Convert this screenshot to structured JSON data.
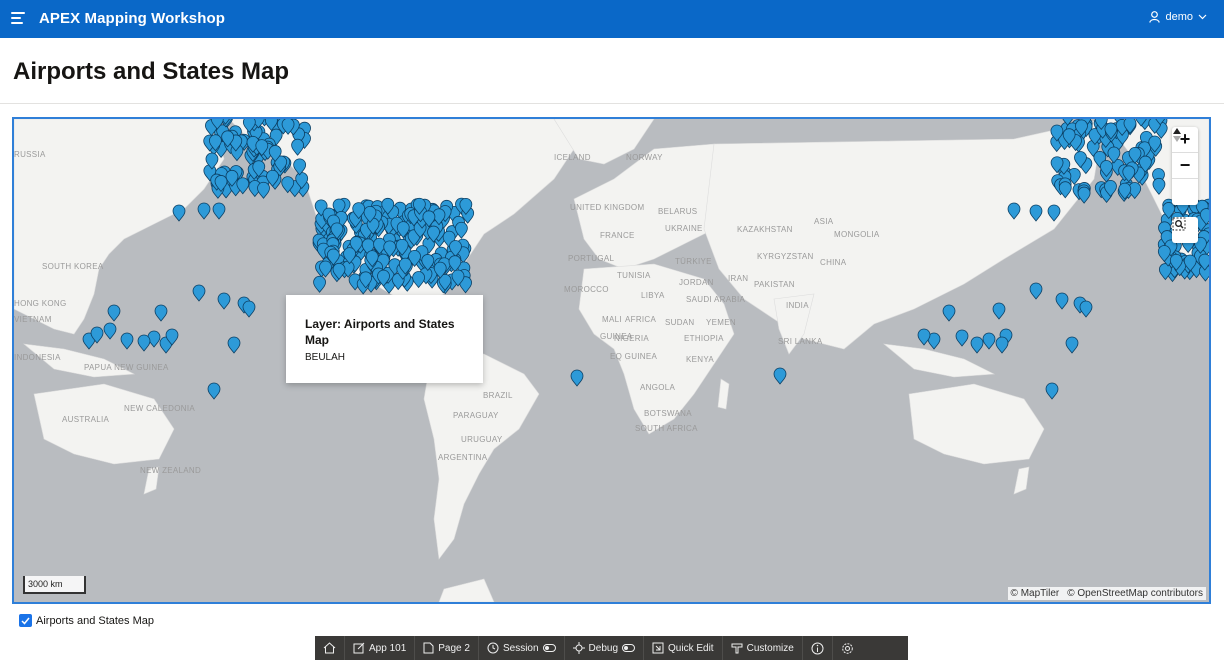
{
  "header": {
    "app_title": "APEX Mapping Workshop",
    "user": "demo",
    "icons": {
      "menu": "hamburger-icon",
      "user": "user-icon",
      "chevron": "chevron-down-icon"
    },
    "color": "#0a68c8"
  },
  "page": {
    "title": "Airports and States Map"
  },
  "map": {
    "ocean_labels": [],
    "country_labels": [
      "RUSSIA",
      "SOUTH KOREA",
      "HONG KONG",
      "VIETNAM",
      "INDONESIA",
      "PAPUA NEW GUINEA",
      "AUSTRALIA",
      "NEW CALEDONIA",
      "NEW ZEALAND",
      "ICELAND",
      "NORWAY",
      "UNITED KINGDOM",
      "BELARUS",
      "FRANCE",
      "UKRAINE",
      "KAZAKHSTAN",
      "MONGOLIA",
      "ASIA",
      "PORTUGAL",
      "TÜRKIYE",
      "KYRGYZSTAN",
      "CHINA",
      "TUNISIA",
      "IRAN",
      "MOROCCO",
      "LIBYA",
      "JORDAN",
      "PAKISTAN",
      "SAUDI ARABIA",
      "INDIA",
      "MALI",
      "AFRICA",
      "SUDAN",
      "YEMEN",
      "GUINEA",
      "NIGERIA",
      "ETHIOPIA",
      "SRI LANKA",
      "EQ GUINEA",
      "KENYA",
      "ANGOLA",
      "BRAZIL",
      "BOTSWANA",
      "PARAGUAY",
      "SOUTH AFRICA",
      "URUGUAY",
      "ARGENTINA"
    ],
    "controls": {
      "zoom_in": "+",
      "zoom_out": "−",
      "north": "compass-icon",
      "zoom_extent": "zoom-extent-icon"
    },
    "popup": {
      "title": "Layer: Airports and States Map",
      "value": "BEULAH"
    },
    "scale": "3000 km",
    "attribution": [
      "© MapTiler",
      "© OpenStreetMap contributors"
    ],
    "marker_color": "#2d9ad8",
    "border_color": "#2f7fd8"
  },
  "legend": {
    "label": "Airports and States Map",
    "checked": true
  },
  "devbar": {
    "items": [
      {
        "label": "",
        "icon": "home-icon"
      },
      {
        "label": "App 101",
        "icon": "edit-icon"
      },
      {
        "label": "Page 2",
        "icon": "page-edit-icon"
      },
      {
        "label": "Session",
        "icon": "session-icon"
      },
      {
        "label": "Debug",
        "icon": "debug-icon"
      },
      {
        "label": "Quick Edit",
        "icon": "quick-edit-icon"
      },
      {
        "label": "Customize",
        "icon": "customize-icon"
      },
      {
        "label": "",
        "icon": "info-icon"
      },
      {
        "label": "",
        "icon": "gear-icon"
      }
    ]
  }
}
